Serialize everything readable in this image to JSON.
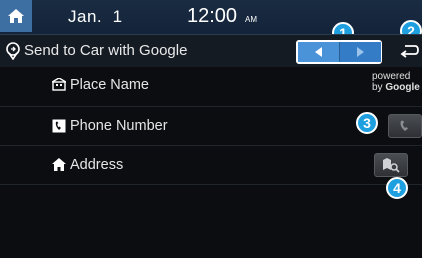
{
  "status": {
    "date": "Jan.  1",
    "time": "12:00",
    "ampm": "AM"
  },
  "header": {
    "title": "Send to Car with Google"
  },
  "list": {
    "place_name": "Place Name",
    "phone_number": "Phone Number",
    "address": "Address"
  },
  "powered_by": {
    "line1": "powered",
    "line2_prefix": "by ",
    "brand": "Google"
  },
  "callouts": [
    "1",
    "2",
    "3",
    "4"
  ],
  "colors": {
    "accent": "#3e7fc0",
    "callout": "#1e9fe0",
    "home": "#3d6fa3"
  },
  "icons": {
    "home": "home-icon",
    "title": "location-send-icon",
    "prev": "triangle-left-icon",
    "next": "triangle-right-icon",
    "back": "back-arrow-icon",
    "place": "building-icon",
    "phone": "phone-icon",
    "address": "house-icon",
    "call": "handset-icon",
    "map": "map-search-icon"
  }
}
